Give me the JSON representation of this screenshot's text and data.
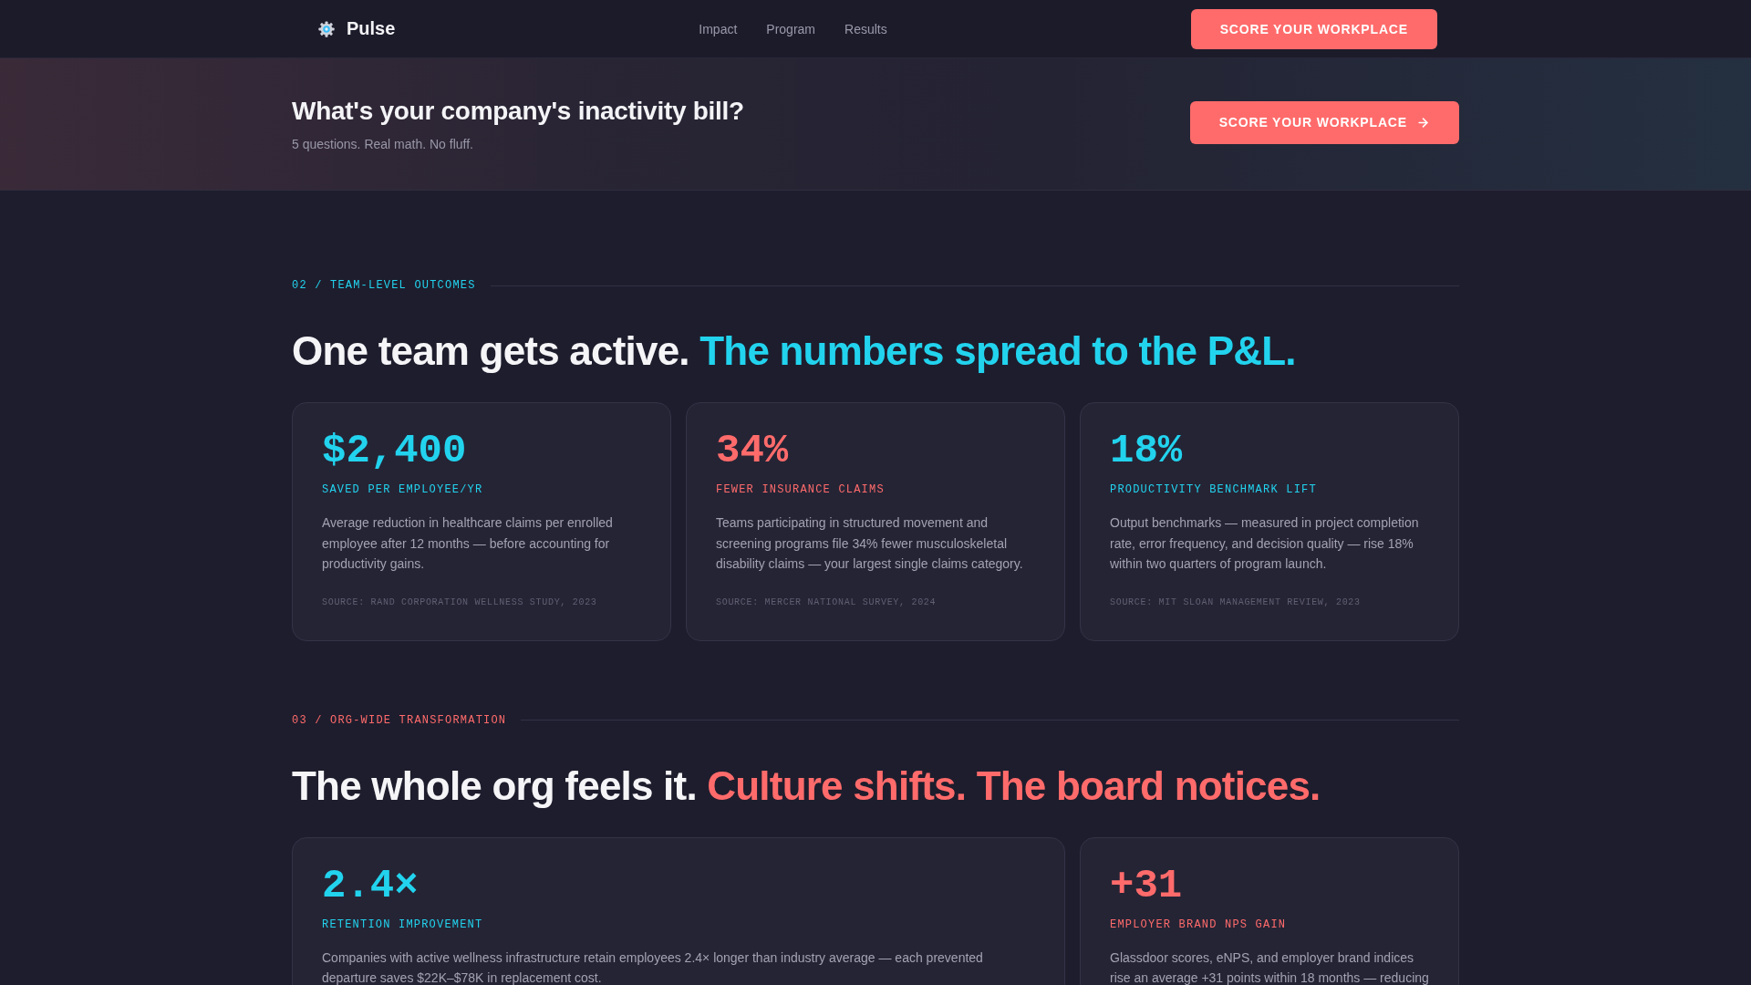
{
  "nav": {
    "brand": "Pulse",
    "links": [
      "Impact",
      "Program",
      "Results"
    ],
    "cta": "SCORE YOUR WORKPLACE"
  },
  "banner": {
    "title": "What's your company's inactivity bill?",
    "subtitle": "5 questions. Real math. No fluff.",
    "cta": "SCORE YOUR WORKPLACE"
  },
  "sections": [
    {
      "label": "02 / TEAM-LEVEL OUTCOMES",
      "color": "#22d3ee",
      "title": "One team gets active.",
      "title_accent": "The numbers spread to the P&L.",
      "cards": [
        {
          "value": "$2,400",
          "label": "SAVED PER EMPLOYEE/YR",
          "color": "#22d3ee",
          "description": "Average reduction in healthcare claims per enrolled employee after 12 months — before accounting for productivity gains.",
          "source": "SOURCE: RAND CORPORATION WELLNESS STUDY, 2023"
        },
        {
          "value": "34%",
          "label": "FEWER INSURANCE CLAIMS",
          "color": "#ff6b6b",
          "description": "Teams participating in structured movement and screening programs file 34% fewer musculoskeletal disability claims — your largest single claims category.",
          "source": "SOURCE: MERCER NATIONAL SURVEY, 2024"
        },
        {
          "value": "18%",
          "label": "PRODUCTIVITY BENCHMARK LIFT",
          "color": "#22d3ee",
          "description": "Output benchmarks — measured in project completion rate, error frequency, and decision quality — rise 18% within two quarters of program launch.",
          "source": "SOURCE: MIT SLOAN MANAGEMENT REVIEW, 2023"
        }
      ]
    },
    {
      "label": "03 / ORG-WIDE TRANSFORMATION",
      "color": "#ff6b6b",
      "title": "The whole org feels it.",
      "title_accent": "Culture shifts. The board notices.",
      "cards": [
        {
          "value": "2.4×",
          "label": "RETENTION IMPROVEMENT",
          "color": "#22d3ee",
          "description": "Companies with active wellness infrastructure retain employees 2.4× longer than industry average — each prevented departure saves $22K–$78K in replacement cost."
        },
        {
          "value": "+31",
          "label": "EMPLOYER BRAND NPS GAIN",
          "color": "#ff6b6b",
          "description": "Glassdoor scores, eNPS, and employer brand indices rise an average +31 points within 18 months — reducing"
        }
      ]
    }
  ]
}
